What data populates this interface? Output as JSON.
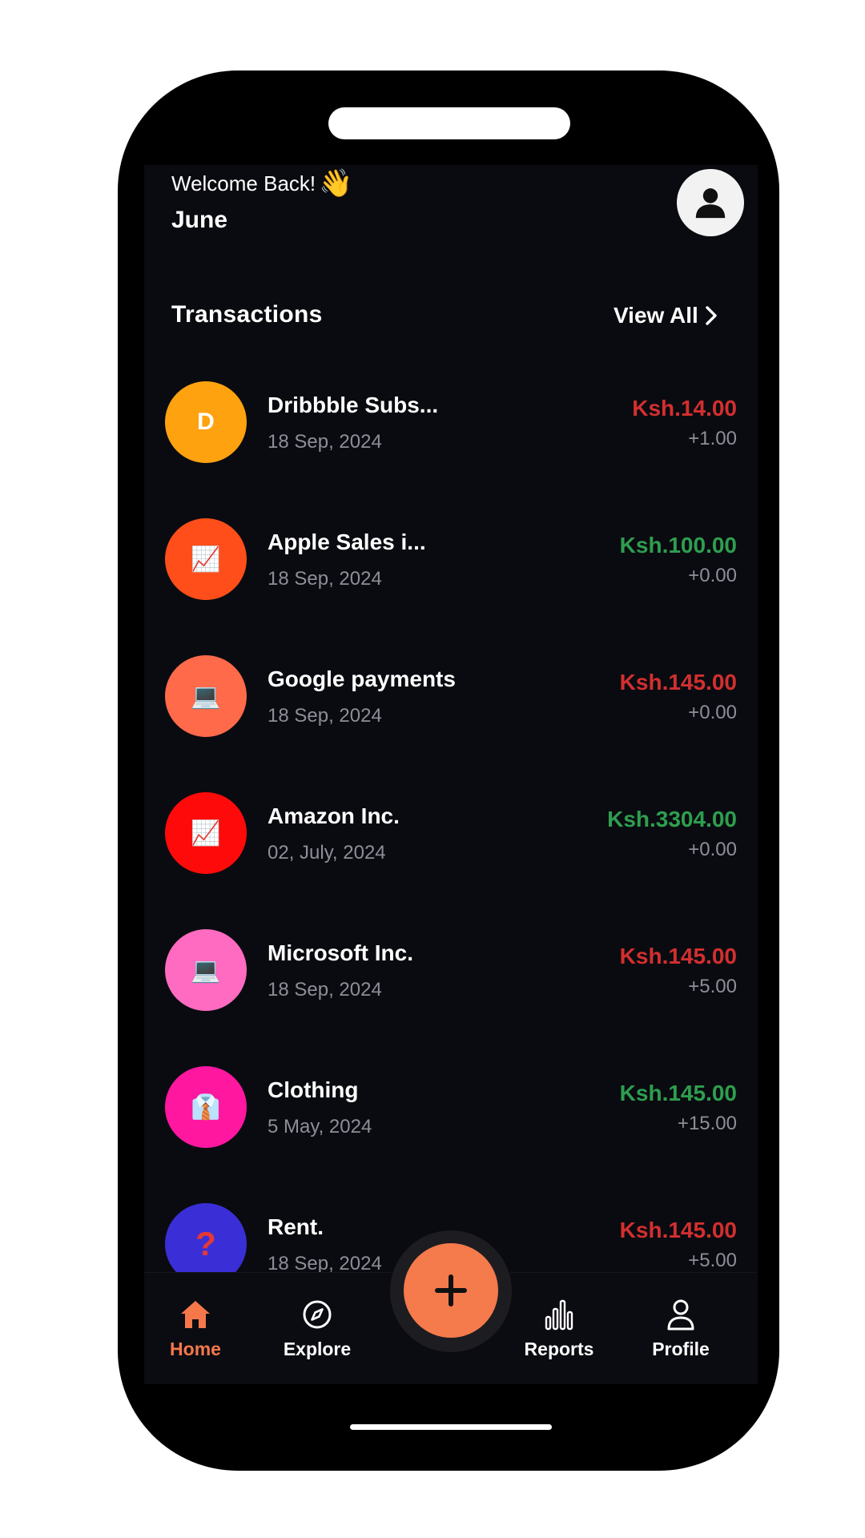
{
  "header": {
    "welcome_text": "Welcome Back!",
    "wave_emoji": "👋",
    "user_name": "June",
    "avatar_icon": "user-avatar-icon"
  },
  "transactions": {
    "title": "Transactions",
    "view_all_label": "View All",
    "items": [
      {
        "icon_text": "D",
        "icon_name": "letter-d-icon",
        "bg": "#FFA20F",
        "name": "Dribbble Subs...",
        "date": "18 Sep, 2024",
        "amount": "Ksh.14.00",
        "amount_color": "#D32F2F",
        "change": "+1.00"
      },
      {
        "icon_text": "📈",
        "icon_name": "chart-increasing-icon",
        "bg": "#FF4E1A",
        "name": "Apple Sales i...",
        "date": "18 Sep, 2024",
        "amount": "Ksh.100.00",
        "amount_color": "#2E9E4F",
        "change": "+0.00"
      },
      {
        "icon_text": "💻",
        "icon_name": "laptop-icon",
        "bg": "#FF6A4A",
        "name": "Google payments",
        "date": "18 Sep, 2024",
        "amount": "Ksh.145.00",
        "amount_color": "#D32F2F",
        "change": "+0.00"
      },
      {
        "icon_text": "📈",
        "icon_name": "chart-increasing-icon",
        "bg": "#FF0A0A",
        "name": "Amazon Inc.",
        "date": "02, July, 2024",
        "amount": "Ksh.3304.00",
        "amount_color": "#2E9E4F",
        "change": "+0.00"
      },
      {
        "icon_text": "💻",
        "icon_name": "laptop-icon",
        "bg": "#FF6BC0",
        "name": "Microsoft Inc.",
        "date": "18 Sep, 2024",
        "amount": "Ksh.145.00",
        "amount_color": "#D32F2F",
        "change": "+5.00"
      },
      {
        "icon_text": "👔",
        "icon_name": "shirt-tie-icon",
        "bg": "#FF17A0",
        "name": "Clothing",
        "date": "5 May, 2024",
        "amount": "Ksh.145.00",
        "amount_color": "#2E9E4F",
        "change": "+15.00"
      },
      {
        "icon_text": "?",
        "icon_name": "question-mark-icon",
        "bg": "#3A2FD6",
        "name": "Rent.",
        "date": "18 Sep, 2024",
        "amount": "Ksh.145.00",
        "amount_color": "#D32F2F",
        "change": "+5.00"
      }
    ]
  },
  "nav": {
    "home": "Home",
    "explore": "Explore",
    "reports": "Reports",
    "profile": "Profile",
    "add_icon": "plus-icon",
    "active_color": "#F5784B"
  }
}
